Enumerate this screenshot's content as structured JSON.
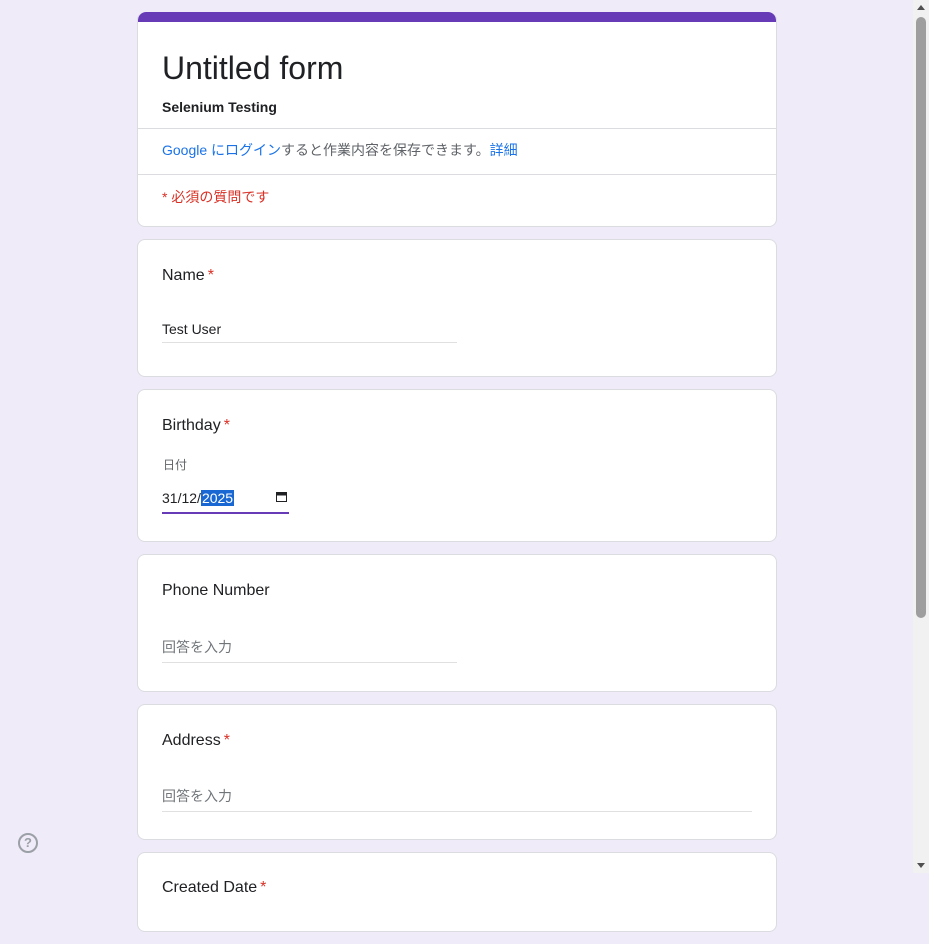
{
  "form": {
    "title": "Untitled form",
    "description": "Selenium Testing",
    "login_link": "Google にログイン",
    "login_text": "すると作業内容を保存できます。",
    "details_link": "詳細",
    "required_note": "* 必須の質問です"
  },
  "questions": {
    "name": {
      "title": "Name",
      "star": "*",
      "value": "Test User"
    },
    "birthday": {
      "title": "Birthday",
      "star": "*",
      "date_label": "日付",
      "date_prefix": "31/12/",
      "date_year": "2025"
    },
    "phone": {
      "title": "Phone Number",
      "placeholder": "回答を入力"
    },
    "address": {
      "title": "Address",
      "star": "*",
      "placeholder": "回答を入力"
    },
    "next": {
      "title": "Created Date",
      "star": "*"
    }
  },
  "help": {
    "glyph": "?"
  },
  "colors": {
    "accent": "#673ab7",
    "required": "#d93025",
    "link": "#1a73e8",
    "background": "#f0ebf8"
  }
}
